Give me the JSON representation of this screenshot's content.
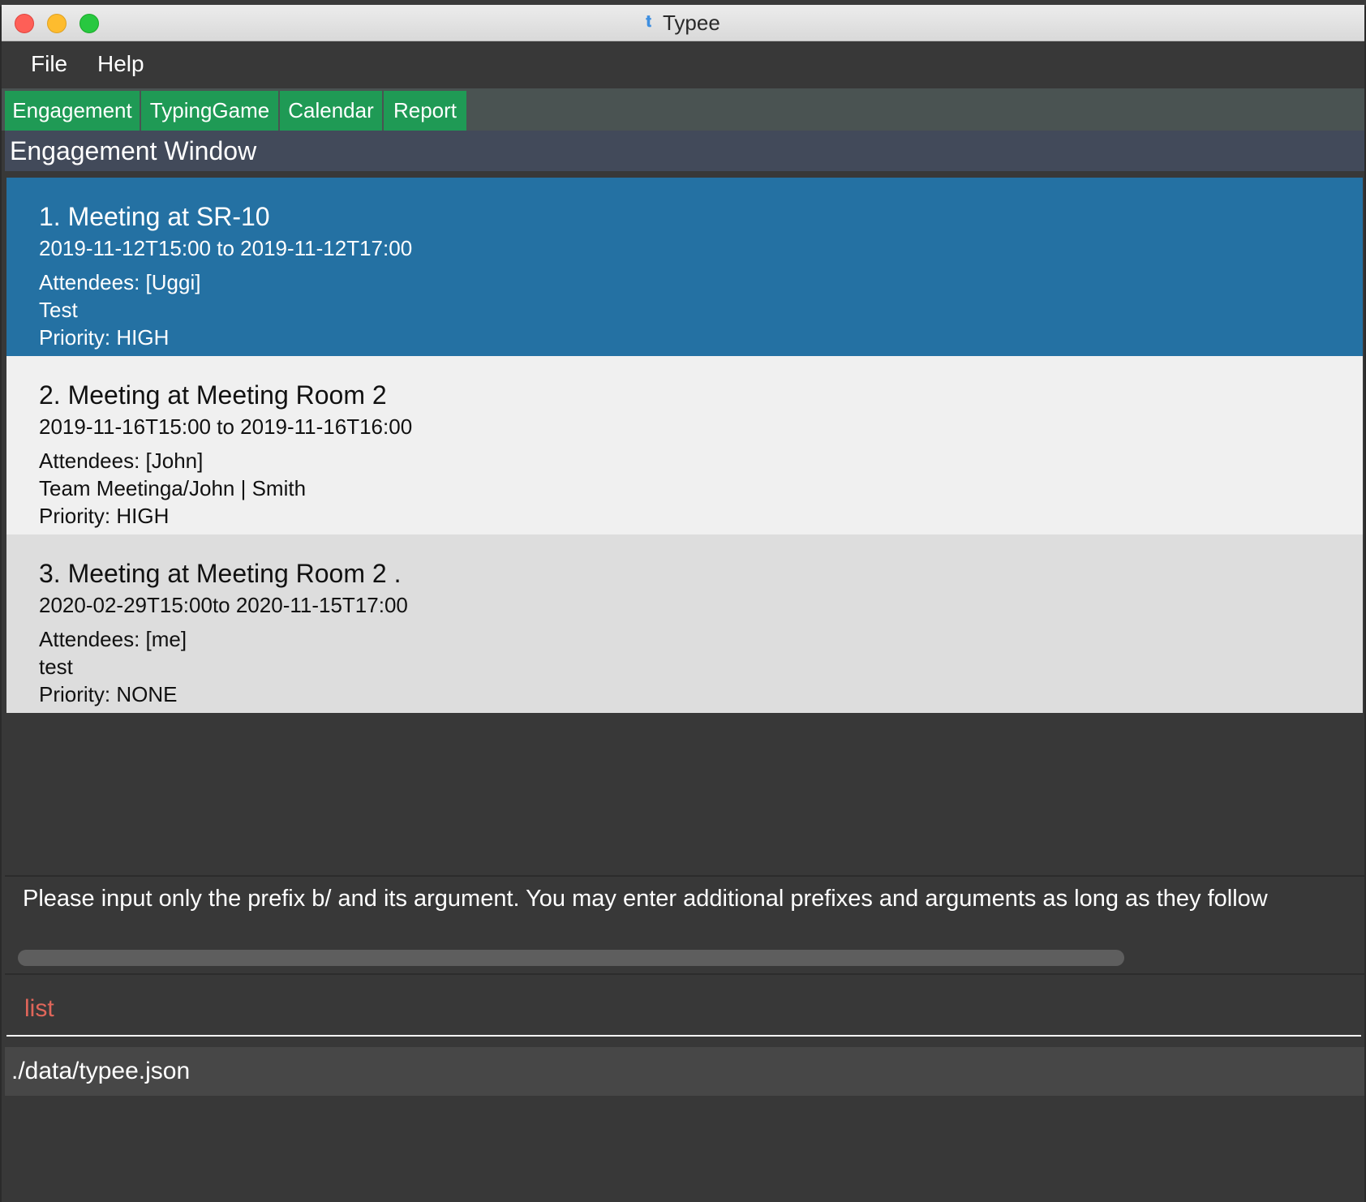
{
  "window": {
    "title": "Typee",
    "title_icon": "typee-app-icon"
  },
  "menu": {
    "file": "File",
    "help": "Help"
  },
  "tabs": [
    {
      "label": "Engagement"
    },
    {
      "label": "TypingGame"
    },
    {
      "label": "Calendar"
    },
    {
      "label": "Report"
    }
  ],
  "header": {
    "title": "Engagement Window"
  },
  "engagements": [
    {
      "title": "1. Meeting at SR-10",
      "date": "2019-11-12T15:00  to  2019-11-12T17:00",
      "attendees": "Attendees: [Uggi]",
      "description": "Test",
      "priority": "Priority: HIGH",
      "selected": true
    },
    {
      "title": "2. Meeting at Meeting Room 2",
      "date": "2019-11-16T15:00  to  2019-11-16T16:00",
      "attendees": "Attendees: [John]",
      "description": "Team Meetinga/John | Smith",
      "priority": "Priority: HIGH",
      "selected": false
    },
    {
      "title": "3. Meeting at Meeting Room 2 .",
      "date": "2020-02-29T15:00to  2020-11-15T17:00",
      "attendees": "Attendees: [me]",
      "description": "test",
      "priority": "Priority: NONE",
      "selected": false
    }
  ],
  "result": {
    "message": "Please input only the prefix b/ and its argument. You may enter additional prefixes and arguments as long as they follow"
  },
  "command": {
    "value": "list"
  },
  "status": {
    "path": "./data/typee.json"
  },
  "colors": {
    "tab_green": "#1f9a55",
    "selected_card": "#2471a3",
    "command_text": "#e0665a",
    "header_bg": "#424a5a"
  }
}
